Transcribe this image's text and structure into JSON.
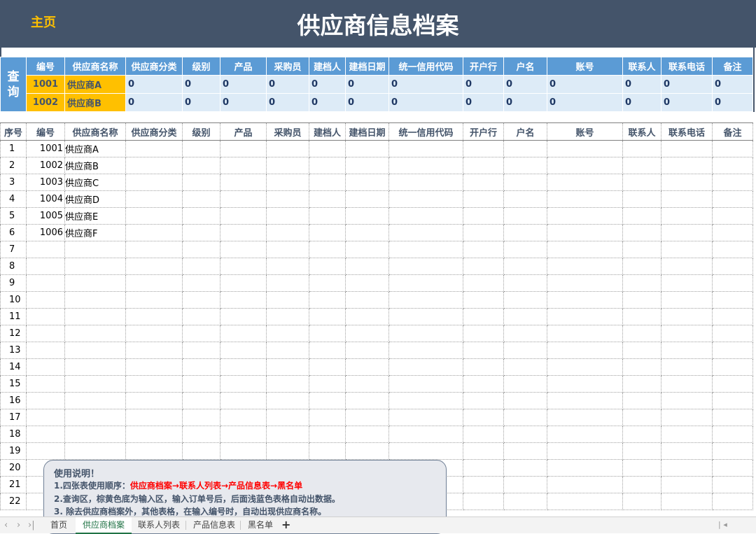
{
  "header": {
    "home": "主页",
    "title": "供应商信息档案"
  },
  "query": {
    "label_chars": [
      "查",
      "询"
    ],
    "columns": [
      "编号",
      "供应商名称",
      "供应商分类",
      "级别",
      "产品",
      "采购员",
      "建档人",
      "建档日期",
      "统一信用代码",
      "开户行",
      "户名",
      "账号",
      "联系人",
      "联系电话",
      "备注"
    ],
    "rows": [
      {
        "code": "1001",
        "name": "供应商A",
        "values": [
          "0",
          "0",
          "0",
          "0",
          "0",
          "0",
          "0",
          "0",
          "0",
          "0",
          "0",
          "0",
          "0"
        ]
      },
      {
        "code": "1002",
        "name": "供应商B",
        "values": [
          "0",
          "0",
          "0",
          "0",
          "0",
          "0",
          "0",
          "0",
          "0",
          "0",
          "0",
          "0",
          "0"
        ]
      }
    ]
  },
  "table": {
    "columns": [
      "序号",
      "编号",
      "供应商名称",
      "供应商分类",
      "级别",
      "产品",
      "采购员",
      "建档人",
      "建档日期",
      "统一信用代码",
      "开户行",
      "户名",
      "账号",
      "联系人",
      "联系电话",
      "备注"
    ],
    "rows": [
      {
        "idx": "1",
        "code": "1001",
        "name": "供应商A"
      },
      {
        "idx": "2",
        "code": "1002",
        "name": "供应商B"
      },
      {
        "idx": "3",
        "code": "1003",
        "name": "供应商C"
      },
      {
        "idx": "4",
        "code": "1004",
        "name": "供应商D"
      },
      {
        "idx": "5",
        "code": "1005",
        "name": "供应商E"
      },
      {
        "idx": "6",
        "code": "1006",
        "name": "供应商F"
      },
      {
        "idx": "7"
      },
      {
        "idx": "8"
      },
      {
        "idx": "9"
      },
      {
        "idx": "10"
      },
      {
        "idx": "11"
      },
      {
        "idx": "12"
      },
      {
        "idx": "13"
      },
      {
        "idx": "14"
      },
      {
        "idx": "15"
      },
      {
        "idx": "16"
      },
      {
        "idx": "17"
      },
      {
        "idx": "18"
      },
      {
        "idx": "19"
      },
      {
        "idx": "20"
      },
      {
        "idx": "21"
      },
      {
        "idx": "22"
      }
    ]
  },
  "note": {
    "title": "使用说明！",
    "line1_prefix": "1.四张表使用顺序：",
    "line1_flow": "供应商档案→联系人列表→产品信息表→黑名单",
    "line2": "2.查询区，棕黄色底为输入区，输入订单号后，后面浅蓝色表格自动出数据。",
    "line3": "3. 除去供应商档案外，其他表格，在输入编号时，自动出现供应商名称。"
  },
  "sheets": {
    "nav": [
      "‹",
      "›",
      "›|"
    ],
    "tabs": [
      "首页",
      "供应商档案",
      "联系人列表",
      "产品信息表",
      "黑名单"
    ],
    "active": 1,
    "add": "+"
  },
  "colors": {
    "banner": "#44546a",
    "accent": "#ffc000",
    "header_blue": "#5b9bd5",
    "output_blue": "#ddebf7",
    "flow_red": "#ff0000"
  }
}
